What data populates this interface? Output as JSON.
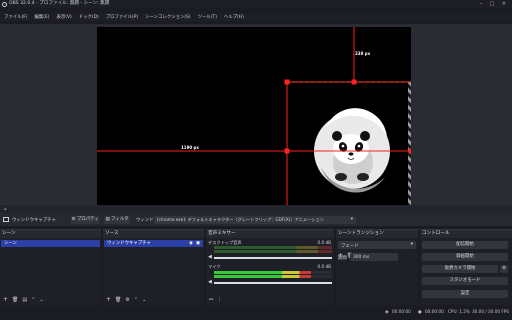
{
  "window": {
    "title": "OBS 32.0.4 - プロファイル: 無題 - シーン: 無題"
  },
  "menu": [
    "ファイル(F)",
    "編集(E)",
    "表示(V)",
    "ドック(D)",
    "プロファイル(P)",
    "シーンコレクション(S)",
    "ツール(T)",
    "ヘルプ(H)"
  ],
  "preview": {
    "dist_top": "238 px",
    "dist_left": "1190 px"
  },
  "source_toolbar": {
    "source_name": "ウィンドウキャプチャ",
    "properties_label": "プロパティ",
    "filters_label": "フィルタ",
    "window_label": "ウィンドウ",
    "window_value": "[chrome.exe]: デフォルトキャラクター（グレートフリップ：GDF(X)）アニメーション"
  },
  "scenes": {
    "title": "シーン",
    "items": [
      "シーン"
    ]
  },
  "sources": {
    "title": "ソース",
    "items": [
      "ウィンドウキャプチャ"
    ]
  },
  "mixer": {
    "title": "音声ミキサー",
    "channels": [
      {
        "name": "デスクトップ音声",
        "db": "0.0 dB",
        "level": 0
      },
      {
        "name": "マイク",
        "db": "0.0 dB",
        "level": 0.82
      }
    ]
  },
  "transitions": {
    "title": "シーントランジション",
    "type": "フェード",
    "duration_label": "期間",
    "duration_value": "300 ms"
  },
  "controls": {
    "title": "コントロール",
    "buttons": [
      "配信開始",
      "録画開始",
      "仮想カメラ開始",
      "スタジオモード",
      "設定"
    ]
  },
  "status": {
    "stream_time": "00:00:00",
    "rec_time": "00:00:00",
    "cpu": "CPU: 1.2%",
    "fps": "30.00 / 30.00 FPS"
  },
  "colors": {
    "accent": "#2c3fa6",
    "guide_red": "#ff2020",
    "guide_green": "#2bd02b"
  }
}
